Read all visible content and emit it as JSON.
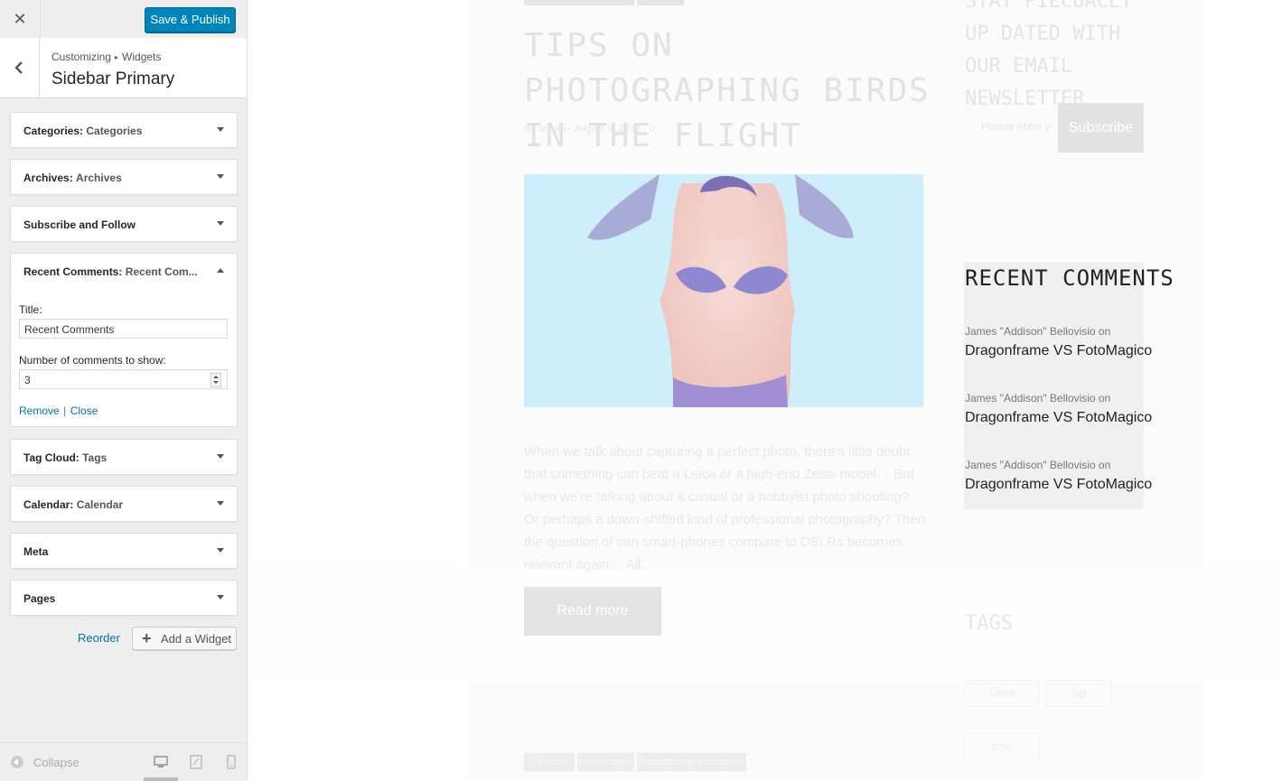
{
  "topbar": {
    "close_glyph": "✕",
    "publish_label": "Save & Publish"
  },
  "section": {
    "crumb_root": "Customizing",
    "crumb_sep": "▸",
    "crumb_child": "Widgets",
    "title": "Sidebar Primary"
  },
  "widgets": [
    {
      "name": "Categories:",
      "instance": "Categories"
    },
    {
      "name": "Archives:",
      "instance": "Archives"
    },
    {
      "name": "Subscribe and Follow",
      "instance": ""
    },
    {
      "name": "Recent Comments:",
      "instance": "Recent Com..."
    },
    {
      "name": "Tag Cloud:",
      "instance": "Tags"
    },
    {
      "name": "Calendar:",
      "instance": "Calendar"
    },
    {
      "name": "Meta",
      "instance": ""
    },
    {
      "name": "Pages",
      "instance": ""
    }
  ],
  "open_widget": {
    "title_label": "Title:",
    "title_value": "Recent Comments",
    "count_label": "Number of comments to show:",
    "count_value": "3",
    "remove_label": "Remove",
    "link_sep": "|",
    "close_label": "Close"
  },
  "panel_actions": {
    "reorder_label": "Reorder",
    "add_widget_label": "Add a Widget",
    "add_glyph": "+"
  },
  "footer": {
    "collapse_label": "Collapse"
  },
  "preview": {
    "post_title": "Tips on photographing birds in the flight",
    "post_meta": "By admin - August 9, 2016 - 0",
    "post_excerpt": "When we talk about capturing a perfect photo, there’s little doubt that something can beat a Leica or a high-end Zeiss model… But when we’re talking about a casual or a hobbyist photo shooting? Or perhaps a down-shifted kind of professional photography? Then the question of can smart-phones compare to DSLRs becomes relevant again… All…",
    "read_more": "Read more",
    "newsletter_text": "Stay Piecuacly up dated with our email newsletter",
    "email_placeholder": "Please enter y",
    "subscribe_label": "Subscribe",
    "recent_comments_title": "Recent Comments",
    "recent_comments": [
      {
        "author": "James \"Addison\" Bellovisio on",
        "post": "Dragonframe VS FotoMagico"
      },
      {
        "author": "James \"Addison\" Bellovisio on",
        "post": "Dragonframe VS FotoMagico"
      },
      {
        "author": "James \"Addison\" Bellovisio on",
        "post": "Dragonframe VS FotoMagico"
      }
    ],
    "tags_title": "Tags",
    "tags": [
      "camo",
      "tag",
      "lmno"
    ],
    "post_categories": [
      "Fineone",
      "Landscapes",
      "Photography techniques"
    ]
  },
  "colors": {
    "accent": "#0085ba",
    "link": "#0073aa",
    "panel_bg": "#eeeeee"
  }
}
